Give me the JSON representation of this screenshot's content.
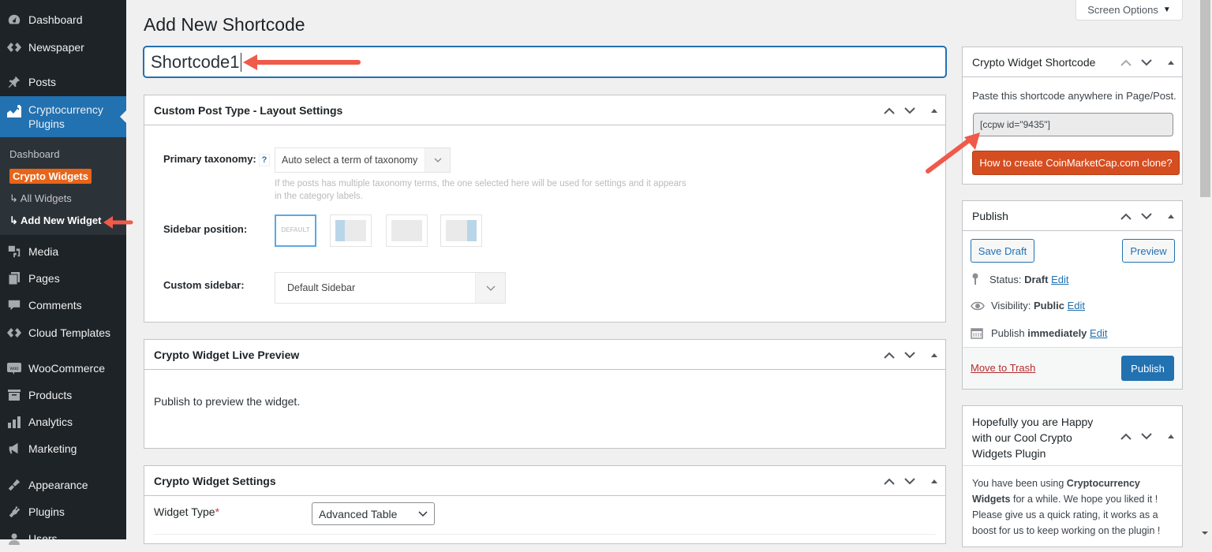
{
  "sidebar": {
    "items": [
      {
        "label": "Dashboard",
        "icon": "dashboard-icon"
      },
      {
        "label": "Newspaper",
        "icon": "newspaper-icon"
      },
      {
        "label": "Posts",
        "icon": "pin-icon"
      },
      {
        "label": "Cryptocurrency Plugins",
        "icon": "chart-icon",
        "active": true
      },
      {
        "label": "Media",
        "icon": "media-icon"
      },
      {
        "label": "Pages",
        "icon": "pages-icon"
      },
      {
        "label": "Comments",
        "icon": "comment-icon"
      },
      {
        "label": "Cloud Templates",
        "icon": "cloud-templates-icon"
      },
      {
        "label": "WooCommerce",
        "icon": "woo-icon"
      },
      {
        "label": "Products",
        "icon": "archive-icon"
      },
      {
        "label": "Analytics",
        "icon": "bar-chart-icon"
      },
      {
        "label": "Marketing",
        "icon": "megaphone-icon"
      },
      {
        "label": "Appearance",
        "icon": "brush-icon"
      },
      {
        "label": "Plugins",
        "icon": "plug-icon"
      },
      {
        "label": "Users",
        "icon": "user-icon"
      }
    ],
    "submenu": {
      "dashboard": "Dashboard",
      "crypto_widgets": "Crypto Widgets",
      "all_widgets": "↳ All Widgets",
      "add_new_widget": "↳ Add New Widget"
    }
  },
  "header": {
    "screen_options": "Screen Options",
    "page_title": "Add New Shortcode",
    "title_value": "Shortcode1"
  },
  "layout_settings": {
    "title": "Custom Post Type - Layout Settings",
    "primary_taxonomy_label": "Primary taxonomy:",
    "help": "?",
    "primary_taxonomy_value": "Auto select a term of taxonomy",
    "hint_line1": "If the posts has multiple taxonomy terms, the one selected here will be used for settings and it appears",
    "hint_line2": "in the category labels.",
    "sidebar_position_label": "Sidebar position:",
    "sidebar_default_text": "DEFAULT",
    "custom_sidebar_label": "Custom sidebar:",
    "custom_sidebar_value": "Default Sidebar"
  },
  "live_preview": {
    "title": "Crypto Widget Live Preview",
    "message": "Publish to preview the widget."
  },
  "widget_settings": {
    "title": "Crypto Widget Settings",
    "widget_type_label": "Widget Type",
    "required": "*",
    "widget_type_value": "Advanced Table"
  },
  "shortcode_box": {
    "title": "Crypto Widget Shortcode",
    "instruction": "Paste this shortcode anywhere in Page/Post.",
    "shortcode": "[ccpw id=\"9435\"]",
    "clone_button": "How to create CoinMarketCap.com clone?",
    "button_color": "#d54e21"
  },
  "publish": {
    "title": "Publish",
    "save_draft": "Save Draft",
    "preview": "Preview",
    "status_label": "Status:",
    "status_value": "Draft",
    "visibility_label": "Visibility:",
    "visibility_value": "Public",
    "publish_label": "Publish",
    "publish_value": "immediately",
    "edit": "Edit",
    "trash": "Move to Trash",
    "publish_button": "Publish"
  },
  "rating": {
    "title_line1": "Hopefully you are Happy",
    "title_line2": "with our Cool Crypto",
    "title_line3": "Widgets Plugin",
    "text_1": "You have been using ",
    "bold_1": "Cryptocurrency",
    "bold_2": "Widgets",
    "text_2": " for a while. We hope you liked it !",
    "text_3": "Please give us a quick rating, it works as a",
    "text_4": "boost for us to keep working on the plugin !"
  }
}
